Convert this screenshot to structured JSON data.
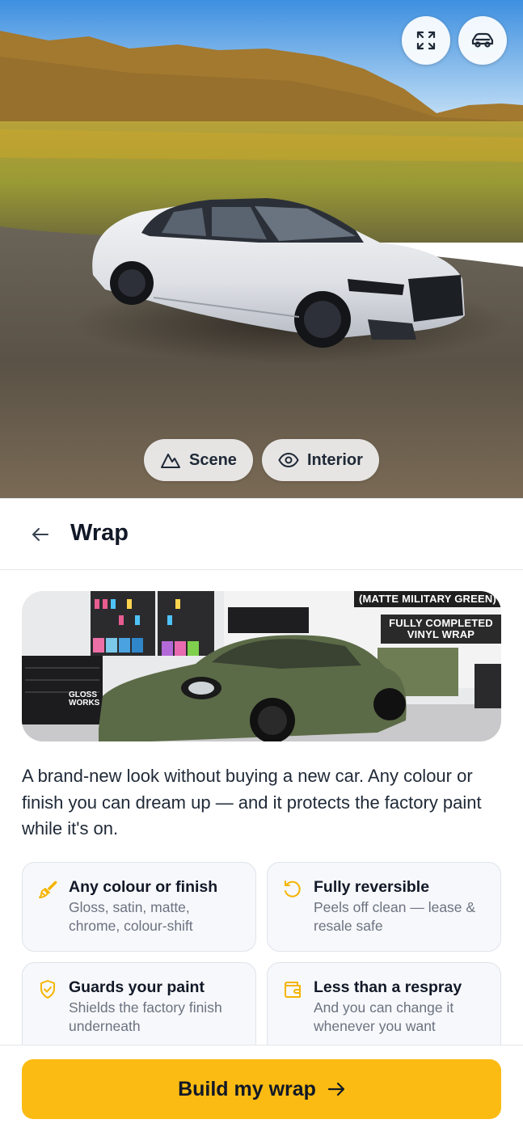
{
  "viewer": {
    "fullscreen_icon": "expand-icon",
    "car_view_icon": "car-icon",
    "scene_label": "Scene",
    "interior_label": "Interior"
  },
  "header": {
    "title": "Wrap"
  },
  "promo": {
    "badge_top": "(MATTE MILITARY GREEN)",
    "badge_main_line1": "FULLY COMPLETED",
    "badge_main_line2": "VINYL WRAP",
    "gloss_line1": "GLOSS",
    "gloss_line2": "WORKS"
  },
  "description": "A brand-new look without buying a new car. Any colour or finish you can dream up — and it protects the factory paint while it's on.",
  "features": [
    {
      "title": "Any colour or finish",
      "subtitle": "Gloss, satin, matte, chrome, colour-shift",
      "icon": "paint-brush-icon"
    },
    {
      "title": "Fully reversible",
      "subtitle": "Peels off clean — lease & resale safe",
      "icon": "undo-icon"
    },
    {
      "title": "Guards your paint",
      "subtitle": "Shields the factory finish underneath",
      "icon": "shield-check-icon"
    },
    {
      "title": "Less than a respray",
      "subtitle": "And you can change it whenever you want",
      "icon": "wallet-icon"
    }
  ],
  "cta": {
    "label": "Build my wrap"
  },
  "colors": {
    "accent": "#fbbb12",
    "icon_accent": "#f5b400",
    "card_bg": "#f7f8fb"
  }
}
